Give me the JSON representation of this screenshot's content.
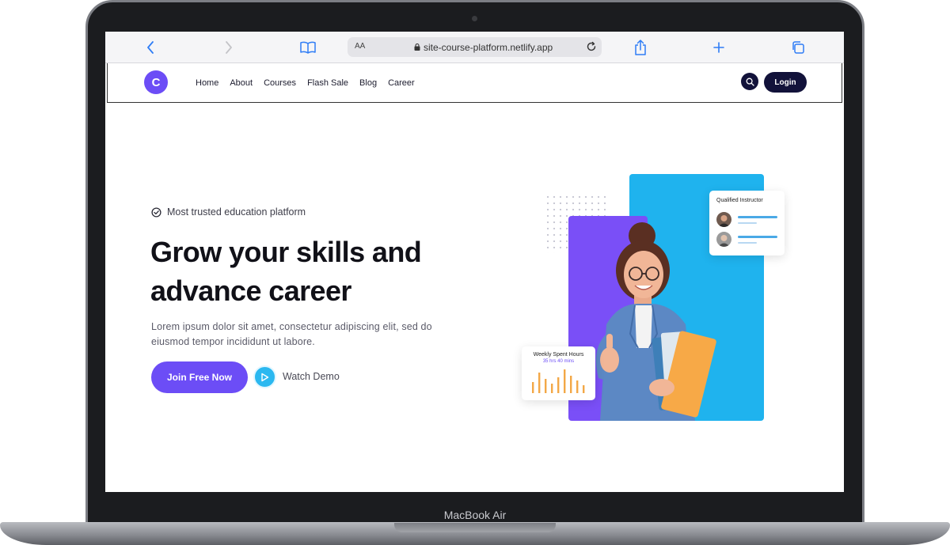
{
  "device": {
    "brand_label": "MacBook Air"
  },
  "browser": {
    "text_size_label": "AA",
    "url": "site-course-platform.netlify.app"
  },
  "nav": {
    "logo_letter": "C",
    "menu": [
      "Home",
      "About",
      "Courses",
      "Flash Sale",
      "Blog",
      "Career"
    ],
    "login_label": "Login"
  },
  "hero": {
    "badge": "Most trusted education platform",
    "headline_line1": "Grow your skills and",
    "headline_line2": "advance career",
    "description_line1": "Lorem ipsum dolor sit amet, consectetur adipiscing elit, sed do",
    "description_line2": "eiusmod tempor incididunt ut labore.",
    "cta_primary": "Join Free Now",
    "cta_secondary": "Watch Demo"
  },
  "cards": {
    "instructor_title": "Qualified Instructor",
    "hours_title": "Weekly Spent Hours",
    "hours_value": "35 hrs 40 mins"
  },
  "colors": {
    "primary": "#6c4df6",
    "dark": "#12123a",
    "accent_blue": "#1fb3ee",
    "bar_orange": "#f3a847"
  }
}
